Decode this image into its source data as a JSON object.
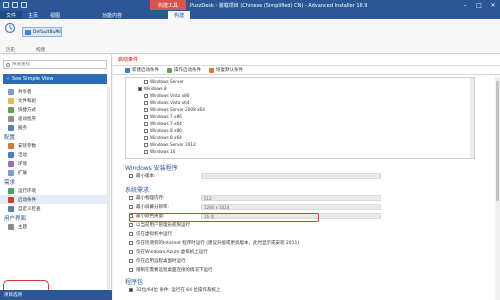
{
  "window": {
    "title": "PuzzDesk - 装载项目 (Chinese (Simplified) CN) - Advanced Installer 16.9",
    "context_tab": "构建工具",
    "controls": [
      "–",
      "□",
      "✕"
    ]
  },
  "ribbon": {
    "tabs": [
      "文件",
      "主页",
      "视图",
      "",
      "功能内容",
      "",
      "构建"
    ],
    "groups": [
      {
        "label": "历史",
        "icon": "history-icon"
      },
      {
        "label": "构建",
        "icon": "build-icon"
      }
    ],
    "build_tab": "DefaultBuild"
  },
  "leftnav": {
    "search_placeholder": "快速查找",
    "simple_view": "See Simple View",
    "items": [
      {
        "type": "item",
        "label": "共享者",
        "icon_color": "#7a9ec9"
      },
      {
        "type": "item",
        "label": "文件和组",
        "icon_color": "#e6b84a"
      },
      {
        "type": "item",
        "label": "快捷方式",
        "icon_color": "#6b9f4b"
      },
      {
        "type": "item",
        "label": "驱动程序",
        "icon_color": "#8f8f8f"
      },
      {
        "type": "item",
        "label": "服务",
        "icon_color": "#5a7fb5"
      },
      {
        "type": "section",
        "label": "配置"
      },
      {
        "type": "item",
        "label": "安装参数",
        "icon_color": "#d47a3b"
      },
      {
        "type": "item",
        "label": "活动",
        "icon_color": "#4a7ec0"
      },
      {
        "type": "item",
        "label": "环境",
        "icon_color": "#9f6bb3"
      },
      {
        "type": "item",
        "label": "扩展",
        "icon_color": "#7a9ec9"
      },
      {
        "type": "section",
        "label": "需求"
      },
      {
        "type": "item",
        "label": "运行环境",
        "icon_color": "#4aa36a"
      },
      {
        "type": "item",
        "label": "启动条件",
        "icon_color": "#d13f2f",
        "selected": true
      },
      {
        "type": "item",
        "label": "自定义检查",
        "icon_color": "#5a7fb5"
      },
      {
        "type": "section",
        "label": "用户界面"
      },
      {
        "type": "item",
        "label": "主题",
        "icon_color": "#8a8a8a"
      }
    ],
    "status": "项目选项"
  },
  "main": {
    "title": "启动条件",
    "toolbar": [
      {
        "label": "新建启动条件",
        "icon_color": "#4a7ec0"
      },
      {
        "label": "操作启动条件",
        "icon_color": "#6b9f4b"
      },
      {
        "label": "恢复默认条件",
        "icon_color": "#d47a3b"
      }
    ],
    "tree": [
      {
        "label": "Windows Server",
        "checked": false,
        "indent": 2
      },
      {
        "label": "Windows 8",
        "checked": true,
        "indent": 1
      },
      {
        "label": "Windows Vista x86",
        "checked": false,
        "indent": 2
      },
      {
        "label": "Windows Vista x64",
        "checked": false,
        "indent": 2
      },
      {
        "label": "Windows Server 2008 x64",
        "checked": false,
        "indent": 2
      },
      {
        "label": "Windows 7 x86",
        "checked": false,
        "indent": 2
      },
      {
        "label": "Windows 7 x64",
        "checked": false,
        "indent": 2
      },
      {
        "label": "Windows 8 x86",
        "checked": false,
        "indent": 2
      },
      {
        "label": "Windows 8 x64",
        "checked": false,
        "indent": 2
      },
      {
        "label": "Windows Server 2012",
        "checked": false,
        "indent": 2
      },
      {
        "label": "Windows 10",
        "checked": false,
        "indent": 2
      }
    ],
    "installer_section": {
      "title": "Windows 安装程序",
      "row": "最小版本:"
    },
    "system_section": {
      "title": "系统需求",
      "rows": [
        {
          "label": "最小物理内存:",
          "value": "512"
        },
        {
          "label": "最小屏幕分辨率:",
          "value": "1280 x 1024"
        },
        {
          "label": "最小颜色质量:",
          "value": "16 位"
        },
        {
          "label": "以当前用户管理员权限运行",
          "value": ""
        },
        {
          "label": "仅在虚拟机中运行",
          "value": ""
        },
        {
          "label": "仅在检测到的Internet 程序时运行 (建议升级或更高版本，此时显示或安装 2011)",
          "value": "",
          "highlight": true
        },
        {
          "label": "仅在Windows Azure 虚拟机上运行",
          "value": ""
        },
        {
          "label": "仅在启用远程桌面时运行",
          "value": ""
        },
        {
          "label": "限制在需要远程桌面连接的情况下运行",
          "value": ""
        }
      ]
    },
    "program_section": {
      "title": "程序包",
      "row": "32位/64位 条件: 运行在 64 位操作系统上"
    }
  }
}
